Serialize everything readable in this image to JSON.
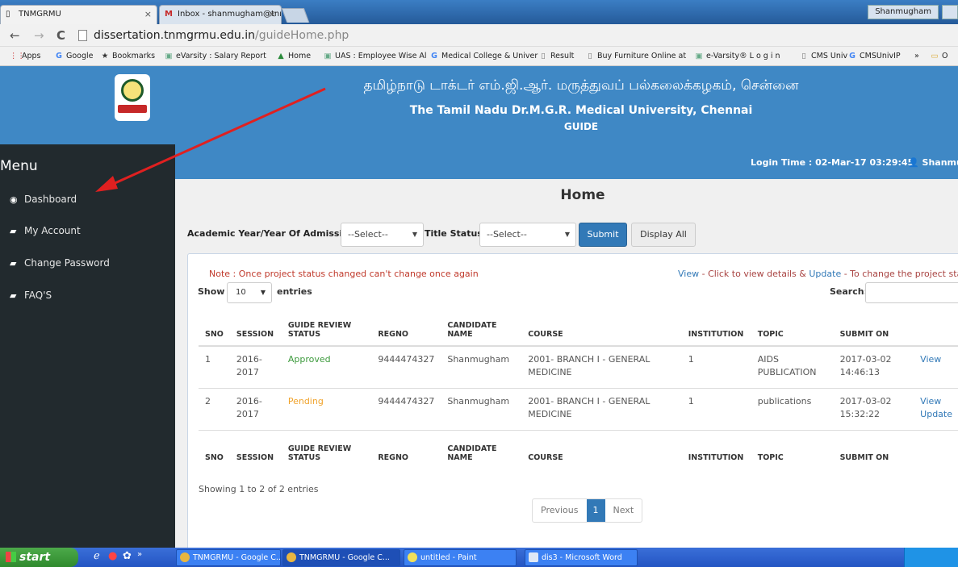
{
  "browser": {
    "tabs": [
      {
        "label": "TNMGRMU",
        "close": "×"
      },
      {
        "label": "Inbox - shanmugham@tnmg",
        "close": "×"
      }
    ],
    "profile": "Shanmugham",
    "url_host": "dissertation.tnmgrmu.edu.in",
    "url_path": "/guideHome.php",
    "bookmarks": [
      "Apps",
      "Google",
      "Bookmarks",
      "eVarsity : Salary Report",
      "Home",
      "UAS : Employee Wise Al",
      "Medical College & Univer",
      "Result",
      "Buy Furniture Online at",
      "e-Varsity® L o g i n",
      "CMS Univ",
      "CMSUnivIP",
      "»",
      "O"
    ]
  },
  "header": {
    "tamil_title": "தமிழ்நாடு டாக்டர் எம்.ஜி.ஆர். மருத்துவப் பல்கலைக்கழகம், சென்னை",
    "english_title": "The Tamil Nadu Dr.M.G.R. Medical University, Chennai",
    "role": "GUIDE"
  },
  "sidebar": {
    "title": "Menu",
    "items": [
      {
        "label": "Dashboard",
        "icon": "dashboard-icon"
      },
      {
        "label": "My Account",
        "icon": "book-icon"
      },
      {
        "label": "Change Password",
        "icon": "book-icon"
      },
      {
        "label": "FAQ'S",
        "icon": "book-icon"
      }
    ]
  },
  "topbar": {
    "login_time": "Login Time : 02-Mar-17 03:29:45",
    "user": "Shanmugham"
  },
  "main": {
    "title": "Home",
    "filter": {
      "year_label": "Academic Year/Year Of Admission",
      "year_value": "--Select--",
      "status_label": "Title Status:",
      "status_value": "--Select--",
      "submit": "Submit",
      "display_all": "Display All"
    },
    "note": "Note : Once project status changed can't change once again",
    "help": {
      "view": "View",
      "view_text": " - Click to view details & ",
      "update": "Update",
      "update_text": " - To change the project status"
    },
    "show": "Show",
    "page_length": "10",
    "entries": "entries",
    "search": "Search:",
    "columns": [
      "SNO",
      "SESSION",
      "GUIDE REVIEW STATUS",
      "REGNO",
      "CANDIDATE NAME",
      "COURSE",
      "INSTITUTION",
      "TOPIC",
      "SUBMIT ON",
      ""
    ],
    "rows": [
      {
        "sno": "1",
        "session": "2016-2017",
        "status": "Approved",
        "regno": "9444474327",
        "name": "Shanmugham",
        "course": "2001- BRANCH I - GENERAL MEDICINE",
        "institution": "1",
        "topic": "AIDS PUBLICATION",
        "submit": "2017-03-02 14:46:13",
        "action1": "View",
        "action2": ""
      },
      {
        "sno": "2",
        "session": "2016-2017",
        "status": "Pending",
        "regno": "9444474327",
        "name": "Shanmugham",
        "course": "2001- BRANCH I - GENERAL MEDICINE",
        "institution": "1",
        "topic": "publications",
        "submit": "2017-03-02 15:32:22",
        "action1": "View",
        "action2": "Update"
      }
    ],
    "showing": "Showing 1 to 2 of 2 entries",
    "pager": {
      "prev": "Previous",
      "current": "1",
      "next": "Next"
    }
  },
  "taskbar": {
    "start": "start",
    "tasks": [
      "TNMGRMU - Google C...",
      "TNMGRMU - Google C...",
      "untitled - Paint",
      "dis3 - Microsoft Word"
    ]
  },
  "colors": {
    "header_blue": "#3f88c5",
    "sidebar": "#222a2e",
    "approved": "#3c9a3c",
    "pending": "#f0a32b",
    "annotation_arrow": "#e02020"
  }
}
